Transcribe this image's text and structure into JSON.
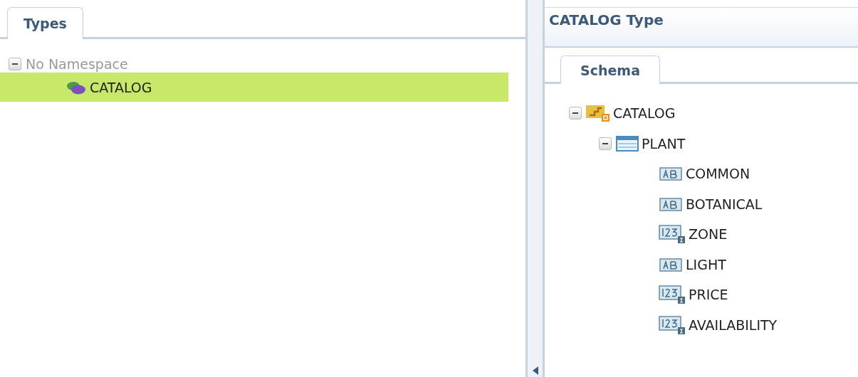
{
  "left": {
    "tabs": [
      {
        "label": "Types",
        "selected": true
      }
    ],
    "tree": [
      {
        "label": "No Namespace",
        "expanded": true,
        "children": [
          {
            "label": "CATALOG",
            "selected": true
          }
        ]
      }
    ]
  },
  "right": {
    "title": "CATALOG Type",
    "tabs": [
      {
        "label": "Schema",
        "selected": true
      }
    ],
    "schema": [
      {
        "label": "CATALOG",
        "kind": "group",
        "expanded": true,
        "children": [
          {
            "label": "PLANT",
            "kind": "complex",
            "expanded": true,
            "children": [
              {
                "label": "COMMON",
                "kind": "string"
              },
              {
                "label": "BOTANICAL",
                "kind": "string"
              },
              {
                "label": "ZONE",
                "kind": "integer"
              },
              {
                "label": "LIGHT",
                "kind": "string"
              },
              {
                "label": "PRICE",
                "kind": "integer"
              },
              {
                "label": "AVAILABILITY",
                "kind": "integer"
              }
            ]
          }
        ]
      }
    ]
  }
}
